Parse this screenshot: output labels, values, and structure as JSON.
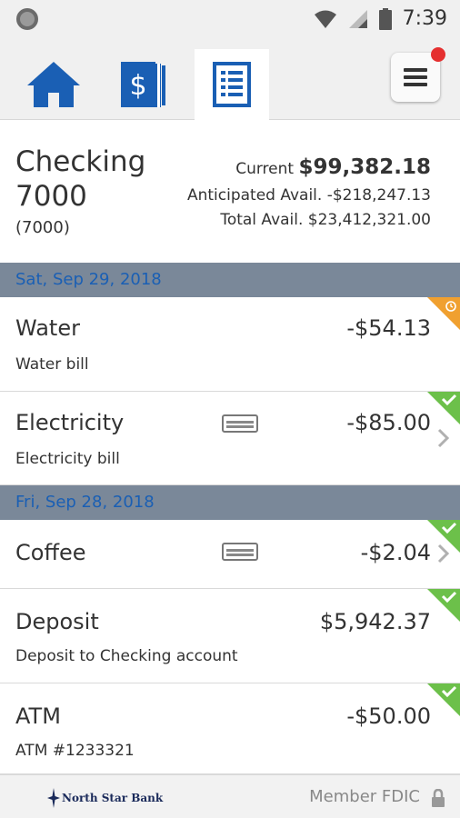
{
  "status": {
    "time": "7:39"
  },
  "tabs": [
    {
      "name": "home",
      "icon": "home-icon"
    },
    {
      "name": "accounts",
      "icon": "dollar-icon"
    },
    {
      "name": "register",
      "icon": "register-icon",
      "active": true
    }
  ],
  "account": {
    "name": "Checking 7000",
    "number": "(7000)",
    "current_label": "Current ",
    "current_value": "$99,382.18",
    "anticipated": "Anticipated Avail. -$218,247.13",
    "total": "Total Avail. $23,412,321.00"
  },
  "groups": [
    {
      "date": "Sat, Sep 29, 2018"
    },
    {
      "date": "Fri, Sep 28, 2018"
    }
  ],
  "transactions": [
    {
      "name": "Water",
      "desc": "Water bill",
      "amount": "-$54.13",
      "status": "pending"
    },
    {
      "name": "Electricity",
      "desc": "Electricity bill",
      "amount": "-$85.00",
      "status": "cleared",
      "card": true,
      "chevron": true
    },
    {
      "name": "Coffee",
      "desc": "",
      "amount": "-$2.04",
      "status": "cleared",
      "card": true,
      "chevron": true
    },
    {
      "name": "Deposit",
      "desc": "Deposit to Checking account",
      "amount": "$5,942.37",
      "status": "cleared"
    },
    {
      "name": "ATM",
      "desc": "ATM #1233321",
      "amount": "-$50.00",
      "status": "cleared"
    }
  ],
  "footer": {
    "bank": "North Star Bank",
    "fdic": "Member FDIC"
  },
  "colors": {
    "brand_blue": "#1a5fb4",
    "date_bar": "#7a8899",
    "cleared": "#6cc04a",
    "pending": "#f0a030",
    "badge": "#e53030"
  }
}
